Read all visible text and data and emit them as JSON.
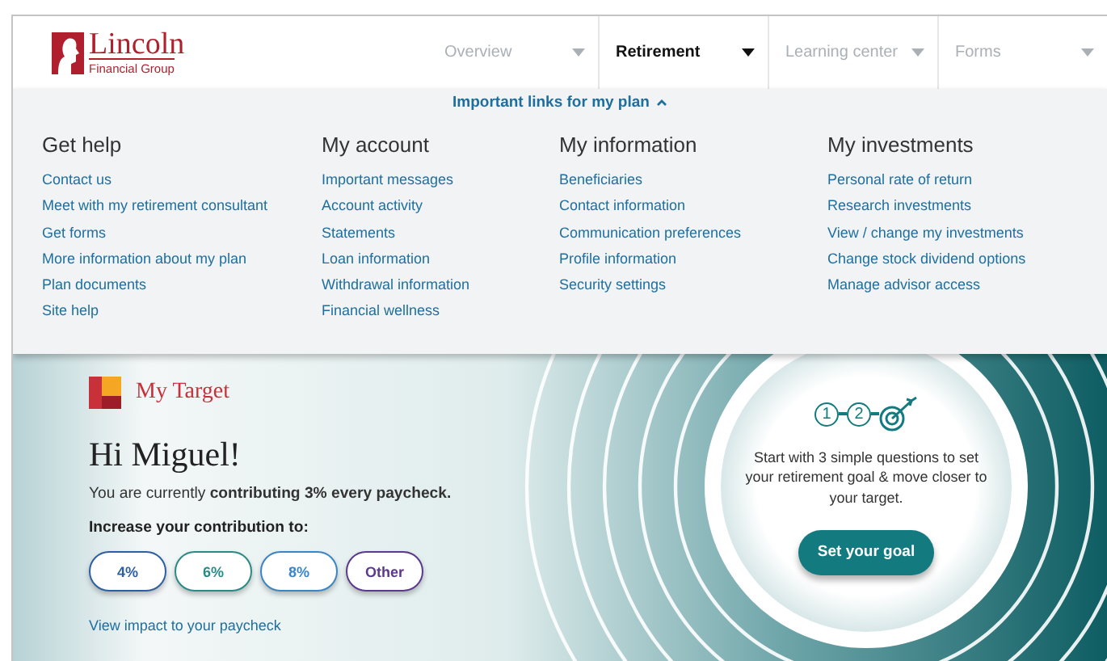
{
  "header": {
    "logo": {
      "name": "Lincoln",
      "subtitle": "Financial Group"
    },
    "tabs": [
      {
        "label": "Overview",
        "selected": false
      },
      {
        "label": "Retirement",
        "selected": true
      },
      {
        "label": "Learning center",
        "selected": false
      },
      {
        "label": "Forms",
        "selected": false
      }
    ]
  },
  "links_toggle": {
    "label": "Important links for my plan",
    "expanded": true
  },
  "link_groups": [
    {
      "title": "Get help",
      "links": [
        "Contact us",
        "Meet with my retirement consultant",
        "Get forms",
        "More information about my plan",
        "Plan documents",
        "Site help"
      ]
    },
    {
      "title": "My account",
      "links": [
        "Important messages",
        "Account activity",
        "Statements",
        "Loan information",
        "Withdrawal information",
        "Financial wellness"
      ]
    },
    {
      "title": "My information",
      "links": [
        "Beneficiaries",
        "Contact information",
        "Communication preferences",
        "Profile information",
        "Security settings"
      ]
    },
    {
      "title": "My investments",
      "links": [
        "Personal rate of return",
        "Research investments",
        "View / change my investments",
        "Change stock dividend options",
        "Manage advisor access"
      ]
    }
  ],
  "hero": {
    "brand": "My Target",
    "greeting": "Hi Miguel!",
    "status": "You are currently **contributing 3% every paycheck.**",
    "prompt": "Increase your contribution to:",
    "options": [
      {
        "label": "4%",
        "color": "#2e5fa3"
      },
      {
        "label": "6%",
        "color": "#2a8a86"
      },
      {
        "label": "8%",
        "color": "#3a86c4"
      },
      {
        "label": "Other",
        "color": "#5b3a8c"
      }
    ],
    "impact_link": "View impact to your paycheck",
    "goal": {
      "steps": [
        "1",
        "2"
      ],
      "text": "Start with 3 simple questions to set your retirement goal & move closer to your target.",
      "button": "Set your goal"
    }
  }
}
